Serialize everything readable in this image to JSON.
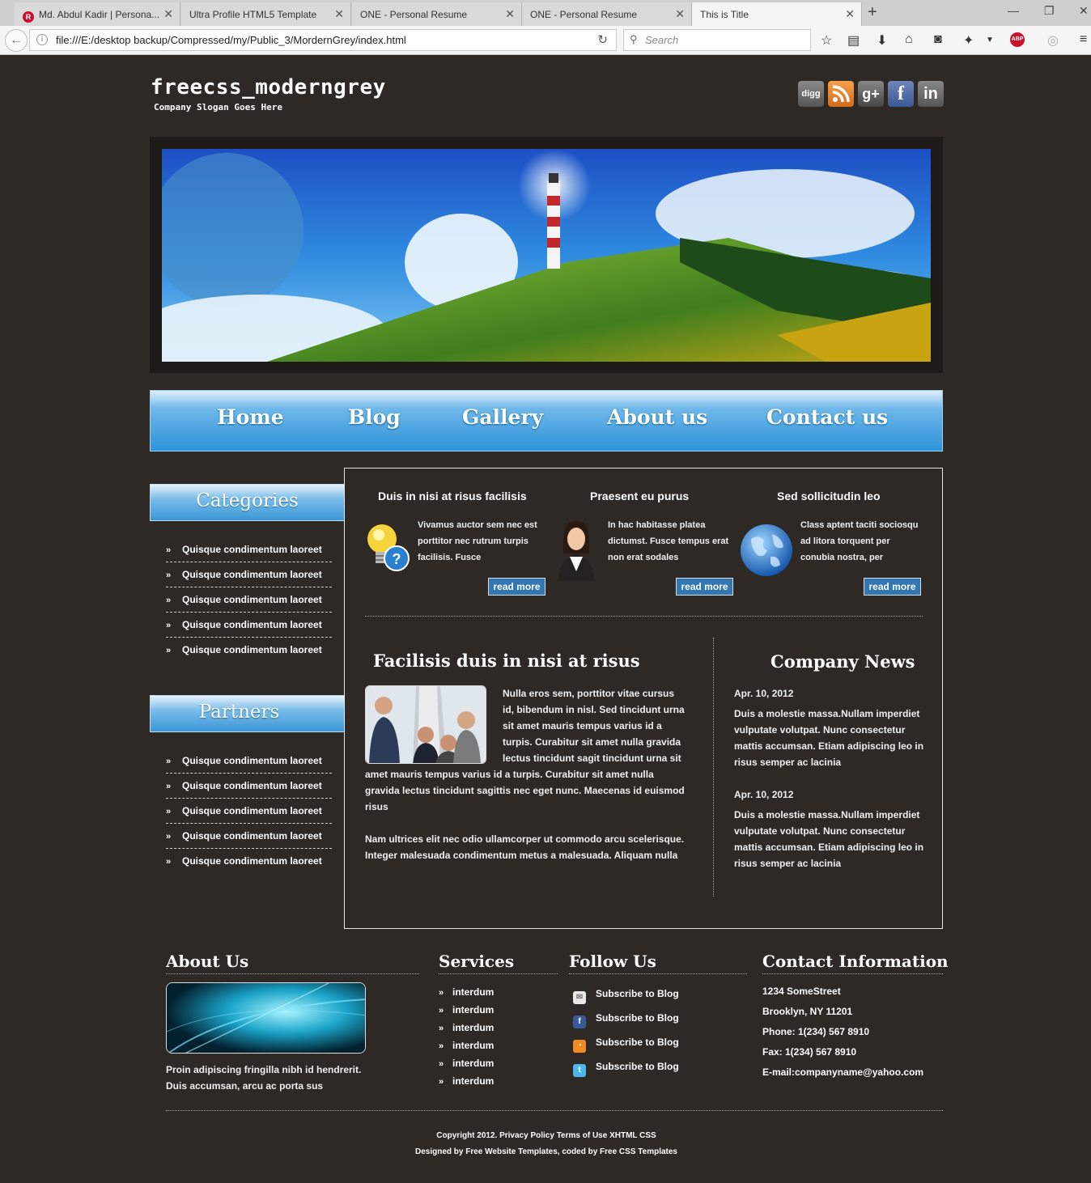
{
  "browser": {
    "tabs": [
      {
        "label": "Md. Abdul Kadir | Persona..."
      },
      {
        "label": "Ultra Profile HTML5 Template"
      },
      {
        "label": "ONE - Personal Resume"
      },
      {
        "label": "ONE - Personal Resume"
      },
      {
        "label": "This is Title"
      }
    ],
    "url": "file:///E:/desktop backup/Compressed/my/Public_3/MordernGrey/index.html",
    "search_placeholder": "Search"
  },
  "header": {
    "logo": "freecss_moderngrey",
    "slogan": "Company Slogan Goes Here",
    "social": [
      "digg",
      "rss",
      "g+",
      "f",
      "in"
    ]
  },
  "menu": [
    "Home",
    "Blog",
    "Gallery",
    "About us",
    "Contact us"
  ],
  "sidebar": {
    "categories_title": "Categories",
    "categories": [
      "Quisque condimentum laoreet",
      "Quisque condimentum laoreet",
      "Quisque condimentum laoreet",
      "Quisque condimentum laoreet",
      "Quisque condimentum laoreet"
    ],
    "partners_title": "Partners",
    "partners": [
      "Quisque condimentum laoreet",
      "Quisque condimentum laoreet",
      "Quisque condimentum laoreet",
      "Quisque condimentum laoreet",
      "Quisque condimentum laoreet"
    ]
  },
  "features": [
    {
      "title": "Duis in nisi at risus facilisis",
      "text": "Vivamus auctor sem nec est porttitor nec rutrum turpis facilisis. Fusce",
      "button": "read more",
      "icon": "lightbulb-icon"
    },
    {
      "title": "Praesent eu purus",
      "text": "In hac habitasse platea dictumst. Fusce tempus erat non erat sodales",
      "button": "read more",
      "icon": "businesswoman-icon"
    },
    {
      "title": "Sed sollicitudin leo",
      "text": "Class aptent taciti sociosqu ad litora torquent per conubia nostra, per",
      "button": "read more",
      "icon": "globe-icon"
    }
  ],
  "article": {
    "title": "Facilisis duis in nisi at risus",
    "para1": "Nulla eros sem, porttitor vitae cursus id, bibendum in nisl. Sed tincidunt urna sit amet mauris tempus varius id a turpis. Curabitur sit amet nulla gravida lectus tincidunt sagit tincidunt urna sit amet mauris tempus varius id a turpis. Curabitur sit amet nulla gravida lectus tincidunt sagittis nec eget nunc. Maecenas id euismod risus",
    "para2": "Nam ultrices elit nec odio ullamcorper ut commodo arcu scelerisque. Integer malesuada condimentum metus a malesuada. Aliquam nulla"
  },
  "news": {
    "title": "Company News",
    "items": [
      {
        "date": "Apr. 10, 2012",
        "text": "Duis a molestie massa.Nullam imperdiet vulputate volutpat. Nunc consectetur mattis accumsan. Etiam adipiscing leo in risus semper ac lacinia"
      },
      {
        "date": "Apr. 10, 2012",
        "text": "Duis a molestie massa.Nullam imperdiet vulputate volutpat. Nunc consectetur mattis accumsan. Etiam adipiscing leo in risus semper ac lacinia"
      }
    ]
  },
  "footer": {
    "about_title": "About Us",
    "about_text": "Proin adipiscing fringilla nibh id hendrerit. Duis accumsan, arcu ac porta sus",
    "services_title": "Services",
    "services": [
      "interdum",
      "interdum",
      "interdum",
      "interdum",
      "interdum",
      "interdum"
    ],
    "follow_title": "Follow Us",
    "follow": [
      {
        "label": "Subscribe to Blog",
        "icon": "mail-icon"
      },
      {
        "label": "Subscribe to Blog",
        "icon": "facebook-icon"
      },
      {
        "label": "Subscribe to Blog",
        "icon": "rss-icon"
      },
      {
        "label": "Subscribe to Blog",
        "icon": "twitter-icon"
      }
    ],
    "contact_title": "Contact Information",
    "contact": [
      "1234 SomeStreet",
      "Brooklyn, NY 11201",
      "Phone: 1(234) 567 8910",
      "Fax: 1(234) 567 8910",
      "E-mail:companyname@yahoo.com"
    ],
    "copyright": "Copyright 2012. Privacy Policy Terms of Use XHTML CSS",
    "designed": "Designed by Free Website Templates, coded by Free CSS Templates"
  }
}
